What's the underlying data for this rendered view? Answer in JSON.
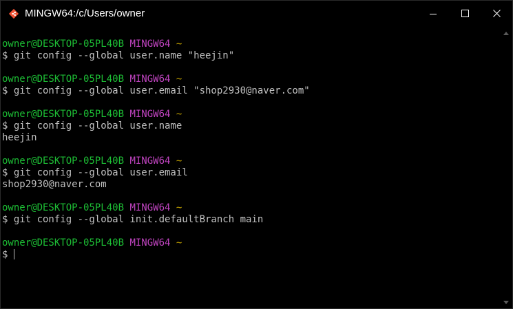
{
  "window": {
    "title": "MINGW64:/c/Users/owner",
    "app_icon": "git-bash-icon",
    "controls": [
      "minimize-icon",
      "maximize-icon",
      "close-icon"
    ]
  },
  "colors": {
    "user": "#1dbf35",
    "env": "#c044c0",
    "path": "#c0a000",
    "text": "#c0c0c0",
    "background": "#000000"
  },
  "terminal": {
    "blocks": [
      {
        "prompt": {
          "user": "owner@DESKTOP-05PL40B",
          "env": "MINGW64",
          "path": "~"
        },
        "command": "$ git config --global user.name \"heejin\"",
        "output": ""
      },
      {
        "prompt": {
          "user": "owner@DESKTOP-05PL40B",
          "env": "MINGW64",
          "path": "~"
        },
        "command": "$ git config --global user.email \"shop2930@naver.com\"",
        "output": ""
      },
      {
        "prompt": {
          "user": "owner@DESKTOP-05PL40B",
          "env": "MINGW64",
          "path": "~"
        },
        "command": "$ git config --global user.name",
        "output": "heejin"
      },
      {
        "prompt": {
          "user": "owner@DESKTOP-05PL40B",
          "env": "MINGW64",
          "path": "~"
        },
        "command": "$ git config --global user.email",
        "output": "shop2930@naver.com"
      },
      {
        "prompt": {
          "user": "owner@DESKTOP-05PL40B",
          "env": "MINGW64",
          "path": "~"
        },
        "command": "$ git config --global init.defaultBranch main",
        "output": ""
      },
      {
        "prompt": {
          "user": "owner@DESKTOP-05PL40B",
          "env": "MINGW64",
          "path": "~"
        },
        "command": "$",
        "output": ""
      }
    ]
  }
}
